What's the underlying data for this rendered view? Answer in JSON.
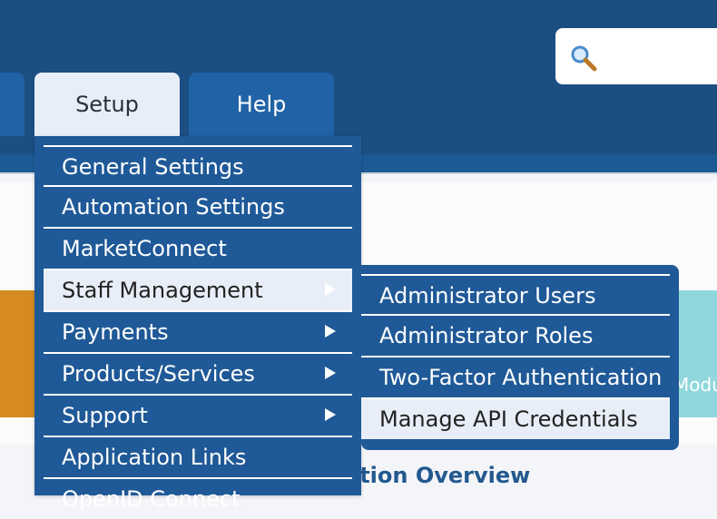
{
  "header": {
    "search": {
      "placeholder": "",
      "icon": "search-icon"
    },
    "tabs": [
      {
        "label": "Setup",
        "active": true
      },
      {
        "label": "Help",
        "active": false
      }
    ]
  },
  "setup_menu": {
    "items": [
      {
        "label": "General Settings",
        "has_submenu": false
      },
      {
        "label": "Automation Settings",
        "has_submenu": false
      },
      {
        "label": "MarketConnect",
        "has_submenu": false
      },
      {
        "label": "Staff Management",
        "has_submenu": true,
        "active": true
      },
      {
        "label": "Payments",
        "has_submenu": true
      },
      {
        "label": "Products/Services",
        "has_submenu": true
      },
      {
        "label": "Support",
        "has_submenu": true
      },
      {
        "label": "Application Links",
        "has_submenu": false
      },
      {
        "label": "OpenID Connect",
        "has_submenu": false
      }
    ]
  },
  "staff_submenu": {
    "items": [
      {
        "label": "Administrator Users"
      },
      {
        "label": "Administrator Roles"
      },
      {
        "label": "Two-Factor Authentication"
      },
      {
        "label": "Manage API Credentials",
        "active": true
      }
    ]
  },
  "background": {
    "overview_title": "ation Overview",
    "teal_panel_text": "Modu"
  },
  "colors": {
    "header_blue": "#1c4e82",
    "menu_blue": "#1f5997",
    "active_bg": "#e8eef8",
    "orange": "#d58b1f",
    "teal": "#8fd7dc",
    "title_blue": "#23598f"
  }
}
